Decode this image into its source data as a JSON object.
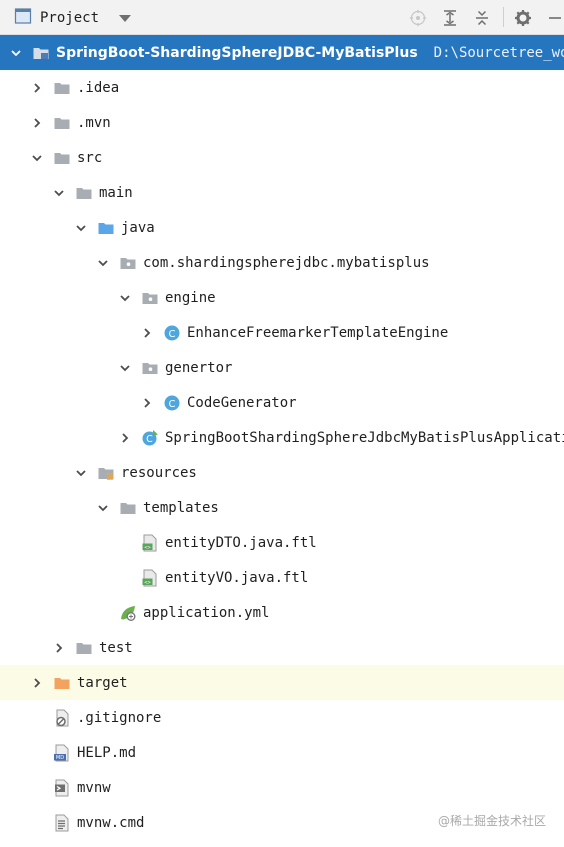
{
  "toolbar": {
    "title": "Project",
    "icons": [
      "target-icon",
      "expand-all-icon",
      "collapse-all-icon",
      "gear-icon",
      "minimize-icon"
    ]
  },
  "root": {
    "name": "SpringBoot-ShardingSphereJDBC-MyBatisPlus",
    "path": "D:\\Sourcetree_workplac"
  },
  "tree": {
    "items": [
      {
        "label": "SpringBoot-ShardingSphereJDBC-MyBatisPlus",
        "depth": 0,
        "type": "module-folder",
        "expanded": true
      },
      {
        "label": ".idea",
        "depth": 1,
        "type": "folder",
        "expanded": false
      },
      {
        "label": ".mvn",
        "depth": 1,
        "type": "folder",
        "expanded": false
      },
      {
        "label": "src",
        "depth": 1,
        "type": "folder",
        "expanded": true
      },
      {
        "label": "main",
        "depth": 2,
        "type": "folder",
        "expanded": true
      },
      {
        "label": "java",
        "depth": 3,
        "type": "source-folder",
        "expanded": true
      },
      {
        "label": "com.shardingspherejdbc.mybatisplus",
        "depth": 4,
        "type": "package",
        "expanded": true
      },
      {
        "label": "engine",
        "depth": 5,
        "type": "package",
        "expanded": true
      },
      {
        "label": "EnhanceFreemarkerTemplateEngine",
        "depth": 6,
        "type": "class",
        "expanded": false
      },
      {
        "label": "genertor",
        "depth": 5,
        "type": "package",
        "expanded": true
      },
      {
        "label": "CodeGenerator",
        "depth": 6,
        "type": "class",
        "expanded": false
      },
      {
        "label": "SpringBootShardingSphereJdbcMyBatisPlusApplication",
        "depth": 5,
        "type": "spring-class",
        "expanded": false
      },
      {
        "label": "resources",
        "depth": 3,
        "type": "resources-folder",
        "expanded": true
      },
      {
        "label": "templates",
        "depth": 4,
        "type": "folder",
        "expanded": true
      },
      {
        "label": "entityDTO.java.ftl",
        "depth": 5,
        "type": "ftl-file"
      },
      {
        "label": "entityVO.java.ftl",
        "depth": 5,
        "type": "ftl-file"
      },
      {
        "label": "application.yml",
        "depth": 4,
        "type": "yml-file"
      },
      {
        "label": "test",
        "depth": 2,
        "type": "folder",
        "expanded": false
      },
      {
        "label": "target",
        "depth": 1,
        "type": "excluded-folder",
        "expanded": false
      },
      {
        "label": ".gitignore",
        "depth": 1,
        "type": "gitignore-file"
      },
      {
        "label": "HELP.md",
        "depth": 1,
        "type": "md-file"
      },
      {
        "label": "mvnw",
        "depth": 1,
        "type": "script-file"
      },
      {
        "label": "mvnw.cmd",
        "depth": 1,
        "type": "text-file"
      }
    ]
  },
  "watermark": "@稀土掘金技术社区",
  "colors": {
    "selection": "#2675bf",
    "folder": "#a8adb3",
    "source_folder": "#5aa6e8",
    "excluded_folder": "#f4a25f",
    "class_icon": "#4ea6dc",
    "spring_icon": "#6ab04c"
  }
}
